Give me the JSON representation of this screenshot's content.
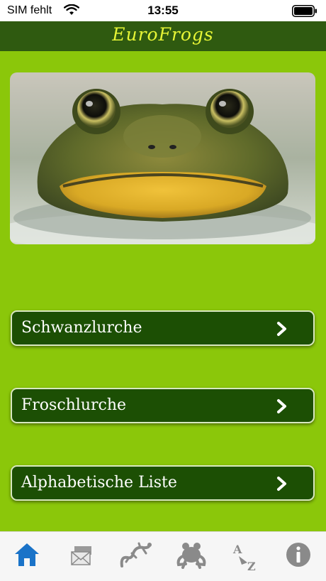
{
  "status_bar": {
    "carrier": "SIM fehlt",
    "time": "13:55"
  },
  "nav": {
    "title": "EuroFrogs"
  },
  "hero": {
    "image": "frog-face-photo"
  },
  "menu": {
    "items": [
      {
        "label": "Schwanzlurche",
        "icon": "chevron-right-icon"
      },
      {
        "label": "Froschlurche",
        "icon": "chevron-right-icon"
      },
      {
        "label": "Alphabetische Liste",
        "icon": "chevron-right-icon"
      }
    ]
  },
  "tabs": [
    {
      "icon": "home-icon",
      "selected": true
    },
    {
      "icon": "envelope-icon",
      "selected": false
    },
    {
      "icon": "salamander-icon",
      "selected": false
    },
    {
      "icon": "frog-icon",
      "selected": false
    },
    {
      "icon": "a-to-z-icon",
      "selected": false
    },
    {
      "icon": "info-icon",
      "selected": false
    }
  ],
  "colors": {
    "nav_background": "#2f5a10",
    "title_color": "#e6f536",
    "content_background": "#8bc70a",
    "button_background": "#1c4f04",
    "tab_selected": "#1a73c8",
    "tab_inactive": "#8a8a8a"
  }
}
